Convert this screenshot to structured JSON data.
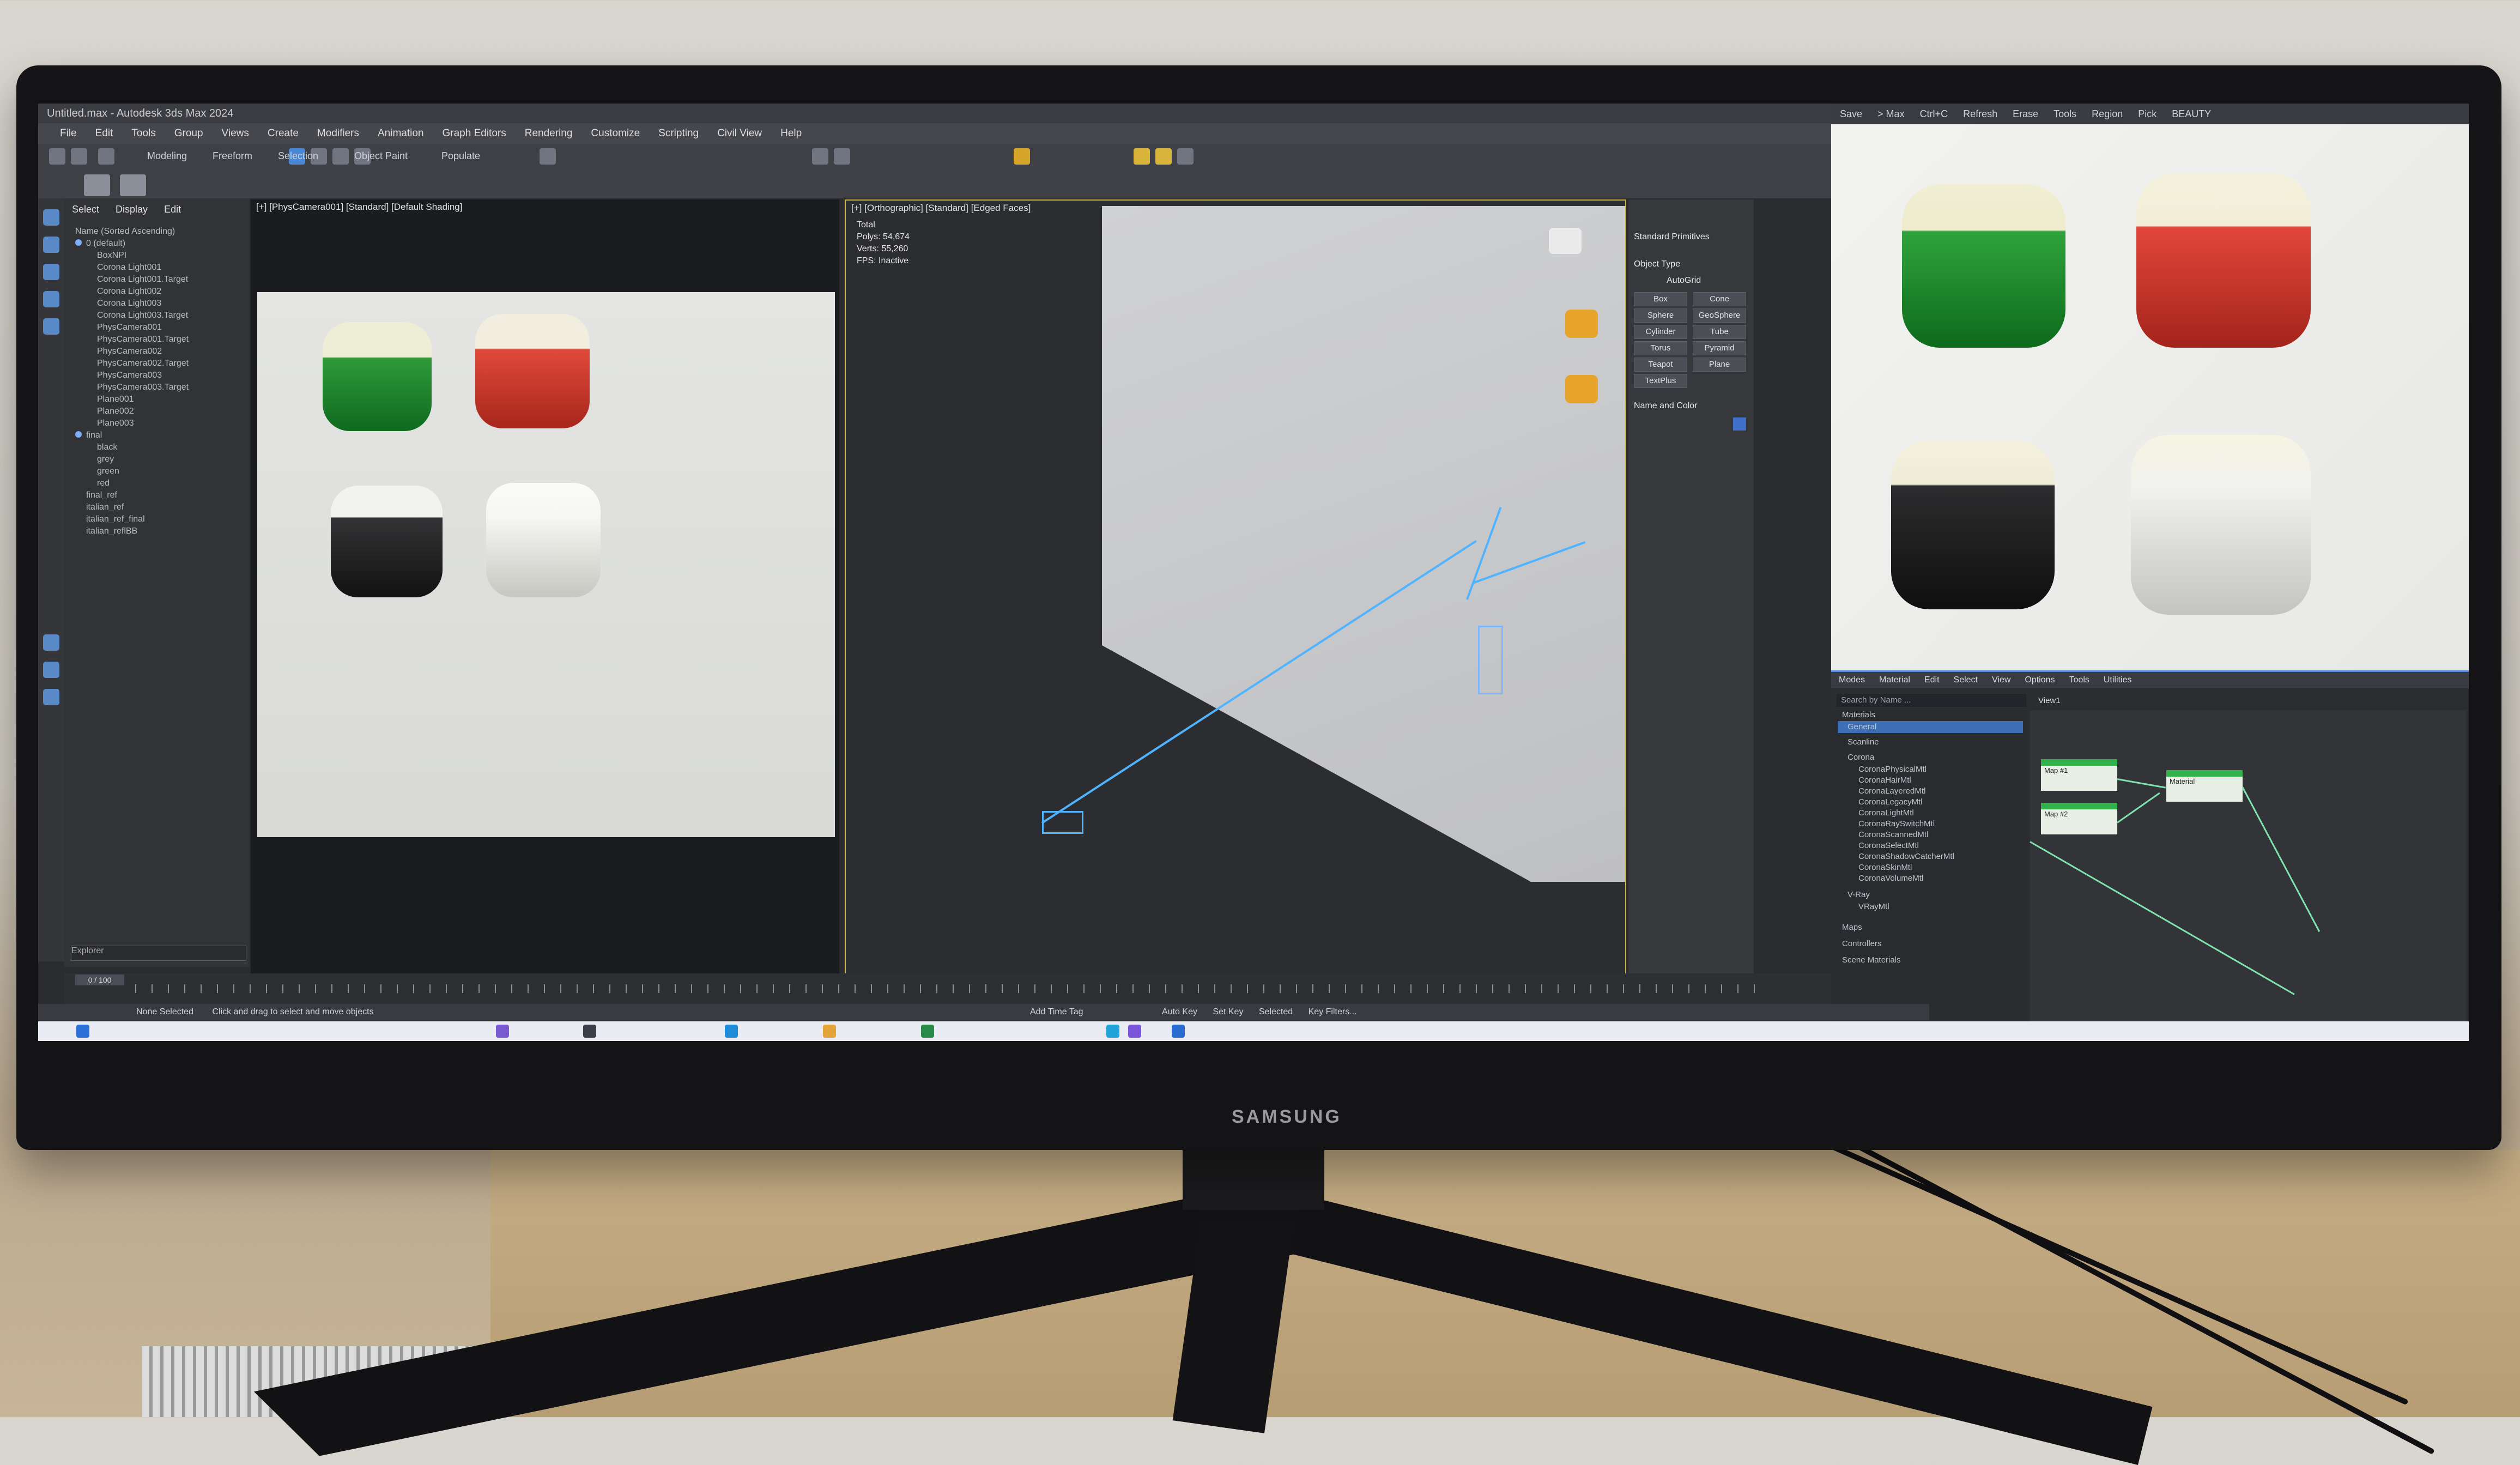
{
  "app": {
    "title": "Untitled.max - Autodesk 3ds Max 2024",
    "menus": [
      "File",
      "Edit",
      "Tools",
      "Group",
      "Views",
      "Create",
      "Modifiers",
      "Animation",
      "Graph Editors",
      "Rendering",
      "Customize",
      "Scripting",
      "Civil View",
      "Help"
    ],
    "ribbon_tabs": [
      "Modeling",
      "Freeform",
      "Selection",
      "Object Paint",
      "Populate"
    ]
  },
  "explorer": {
    "tabs": [
      "Select",
      "Display",
      "Edit"
    ],
    "items": [
      "Name (Sorted Ascending)",
      "0 (default)",
      "BoxNPI",
      "Corona Light001",
      "Corona Light001.Target",
      "Corona Light002",
      "Corona Light003",
      "Corona Light003.Target",
      "PhysCamera001",
      "PhysCamera001.Target",
      "PhysCamera002",
      "PhysCamera002.Target",
      "PhysCamera003",
      "PhysCamera003.Target",
      "Plane001",
      "Plane002",
      "Plane003",
      "final",
      "black",
      "grey",
      "green",
      "red",
      "final_ref",
      "italian_ref",
      "italian_ref_final",
      "italian_reflBB"
    ],
    "bottom_label": "Explorer"
  },
  "viewport_left": {
    "label": "[+] [PhysCamera001] [Standard] [Default Shading]"
  },
  "viewport_right": {
    "label": "[+] [Orthographic] [Standard] [Edged Faces]",
    "stats": [
      "Total",
      "Polys: 54,674",
      "Verts: 55,260",
      "FPS: Inactive"
    ]
  },
  "command_panel": {
    "category": "Standard Primitives",
    "section_object_type": "Object Type",
    "autogrid": "AutoGrid",
    "buttons": [
      "Box",
      "Cone",
      "Sphere",
      "GeoSphere",
      "Cylinder",
      "Tube",
      "Torus",
      "Pyramid",
      "Teapot",
      "Plane",
      "TextPlus"
    ],
    "section_name_color": "Name and Color"
  },
  "frame_buffer": {
    "toolbar": [
      "Save",
      "> Max",
      "Ctrl+C",
      "Refresh",
      "Erase",
      "Tools",
      "Region",
      "Pick",
      "BEAUTY"
    ],
    "swatches": [
      {
        "name": "green",
        "color": "#1f8f2e"
      },
      {
        "name": "red",
        "color": "#c8372d"
      },
      {
        "name": "black",
        "color": "#1b1b1c"
      },
      {
        "name": "white",
        "color": "#d8d8d4"
      }
    ]
  },
  "slate": {
    "menu": [
      "Modes",
      "Material",
      "Edit",
      "Select",
      "View",
      "Options",
      "Tools",
      "Utilities"
    ],
    "view_tab": "View1",
    "search": "Search by Name ...",
    "tree": [
      "Materials",
      "General",
      "Scanline",
      "Corona",
      "CoronaPhysicalMtl",
      "CoronaHairMtl",
      "CoronaLayeredMtl",
      "CoronaLegacyMtl",
      "CoronaLightMtl",
      "CoronaRaySwitchMtl",
      "CoronaScannedMtl",
      "CoronaSelectMtl",
      "CoronaShadowCatcherMtl",
      "CoronaSkinMtl",
      "CoronaVolumeMtl",
      "V-Ray",
      "VRayMtl",
      "Maps",
      "Controllers",
      "Scene Materials"
    ],
    "nodes": [
      "Map #1",
      "Map #2",
      "Material"
    ]
  },
  "status": {
    "selection": "None Selected",
    "hint": "Click and drag to select and move objects",
    "add_time_tag": "Add Time Tag",
    "auto_key": "Auto Key",
    "set_key": "Set Key",
    "selected": "Selected",
    "key_filters": "Key Filters..."
  },
  "timeline": {
    "range": "0 / 100"
  },
  "monitor_brand": "SAMSUNG"
}
